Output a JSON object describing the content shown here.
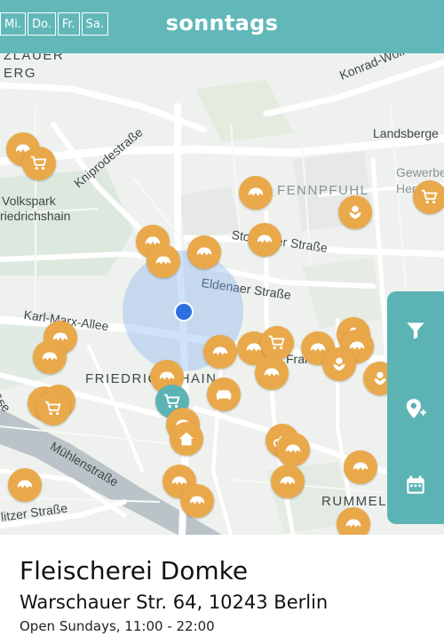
{
  "topbar": {
    "title": "sonntags",
    "days": [
      "Mi.",
      "Do.",
      "Fr.",
      "Sa."
    ]
  },
  "map": {
    "labels": {
      "zlauer": "ZLAUER",
      "berg": "ERG",
      "konrad": "Konrad-Wolf-S",
      "landsberger": "Landsberge",
      "kniprode": "Kniprodestraße",
      "volkspark1": "Volkspark",
      "volkspark2": "riedrichshain",
      "fennpfuhl": "FENNPFUHL",
      "gewerbe1": "Gewerbe",
      "gewerbe2": "Her",
      "storkower": "Storkower Straße",
      "eldenaer": "Eldenaer Straße",
      "karlmarx": "Karl-Marx-Allee",
      "frankfurter": "Frankfurter",
      "friedrichshain": "FRIEDRICHSHAIN",
      "muehlen": "Mühlenstraße",
      "rummel": "RUMMEL",
      "ritzer": "litzer Straße",
      "sse": "Sse"
    }
  },
  "sidepanel": {
    "filter": "filter-icon",
    "add_location": "add-location-icon",
    "calendar": "calendar-icon"
  },
  "selected": {
    "name": "Fleischerei Domke",
    "address": "Warschauer Str. 64, 10243 Berlin",
    "hours": "Open Sundays, 11:00 - 22:00"
  },
  "colors": {
    "accent": "#62b8b9",
    "marker": "#e9a94b",
    "location": "#2e6fe0"
  }
}
